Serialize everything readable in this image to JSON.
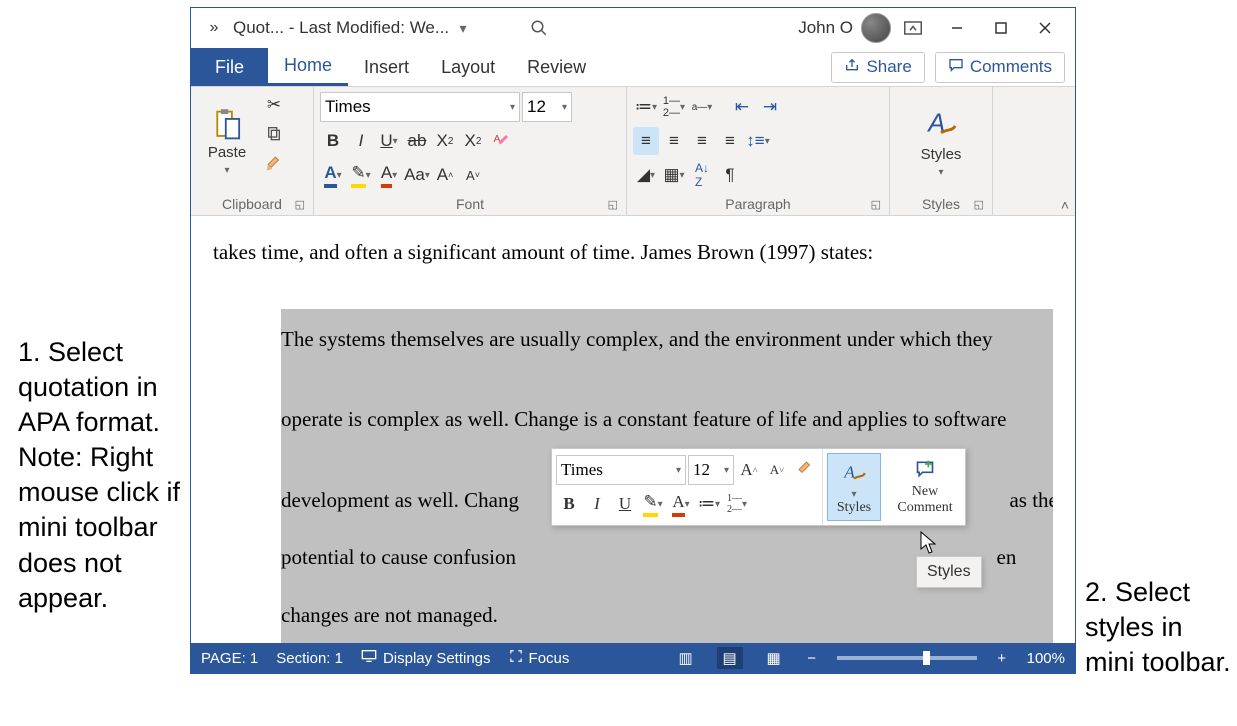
{
  "annotations": {
    "left": "1. Select quotation in APA format. Note: Right mouse click if mini toolbar does not appear.",
    "right": "2. Select styles in mini toolbar."
  },
  "titlebar": {
    "doc_title": "Quot...  - Last Modified: We...",
    "user_name": "John O"
  },
  "tabs": {
    "file": "File",
    "home": "Home",
    "insert": "Insert",
    "layout": "Layout",
    "review": "Review",
    "share": "Share",
    "comments": "Comments"
  },
  "ribbon": {
    "clipboard_label": "Clipboard",
    "paste_label": "Paste",
    "font_label": "Font",
    "font_name": "Times",
    "font_size": "12",
    "case_label": "Aa",
    "paragraph_label": "Paragraph",
    "styles_label": "Styles",
    "styles_btn": "Styles"
  },
  "document": {
    "top_line": "takes time, and often a significant amount of time. James Brown (1997) states:",
    "sel_line1": "The systems themselves are usually complex, and the environment under which they",
    "sel_line2": "operate is complex as well. Change is a constant feature of life and applies to software",
    "sel_line3_a": "development as well. Chang",
    "sel_line3_b": "as the",
    "sel_line4_a": "potential to cause confusion",
    "sel_line4_b": "en",
    "sel_line5": "changes are not managed."
  },
  "mini": {
    "font_name": "Times",
    "font_size": "12",
    "styles": "Styles",
    "new_comment_l1": "New",
    "new_comment_l2": "Comment"
  },
  "tooltip": {
    "text": "Styles"
  },
  "statusbar": {
    "page": "PAGE: 1",
    "section": "Section: 1",
    "display": "Display Settings",
    "focus": "Focus",
    "zoom": "100%"
  }
}
